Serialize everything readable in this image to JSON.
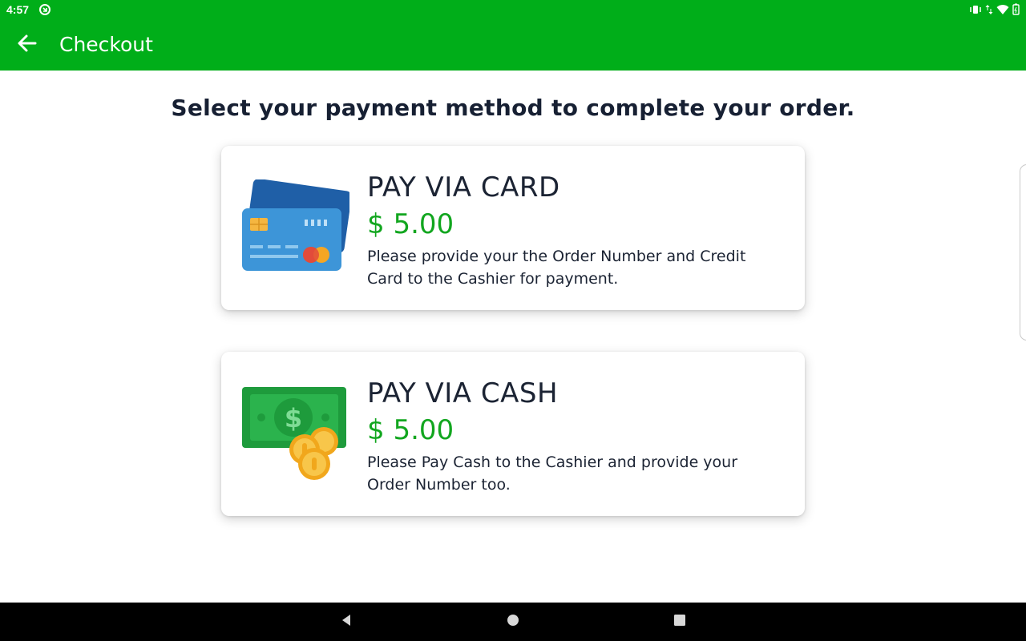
{
  "status_bar": {
    "time": "4:57",
    "app_icon": "circle-arrow-icon",
    "right_icons": [
      "vibrate-icon",
      "data-arrows-icon",
      "wifi-icon",
      "battery-icon"
    ]
  },
  "app_bar": {
    "title": "Checkout",
    "back_icon": "arrow-left-icon",
    "color": "#00ae19"
  },
  "main": {
    "headline": "Select your payment method to complete your order.",
    "options": [
      {
        "title": "PAY VIA CARD",
        "price": "$ 5.00",
        "description": "Please provide your the Order Number and Credit Card to the Cashier for payment.",
        "icon": "credit-card-icon"
      },
      {
        "title": "PAY VIA CASH",
        "price": "$ 5.00",
        "description": "Please Pay Cash to the Cashier and provide your Order Number too.",
        "icon": "cash-coins-icon"
      }
    ]
  },
  "nav_bar": {
    "items": [
      "back-triangle-icon",
      "home-circle-icon",
      "recents-square-icon"
    ]
  },
  "colors": {
    "brand_green": "#00ae19",
    "price_green": "#12a61f",
    "text_dark": "#1b2333"
  }
}
